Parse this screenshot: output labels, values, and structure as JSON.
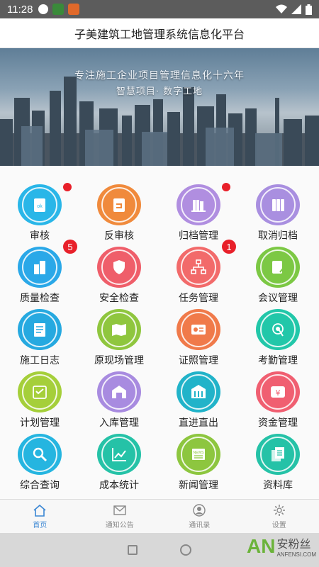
{
  "status": {
    "time": "11:28"
  },
  "title": "子美建筑工地管理系统信息化平台",
  "banner": {
    "line1": "专注施工企业项目管理信息化十六年",
    "line2": "智慧项目· 数字工地"
  },
  "modules": [
    {
      "label": "审核",
      "icon": "clipboard-ok-icon",
      "color": "#29b6e8",
      "badge": "dot"
    },
    {
      "label": "反审核",
      "icon": "clipboard-return-icon",
      "color": "#f08a3c",
      "badge": ""
    },
    {
      "label": "归档管理",
      "icon": "archive-books-icon",
      "color": "#b08ee0",
      "badge": "dot"
    },
    {
      "label": "取消归档",
      "icon": "binders-icon",
      "color": "#a98fe0",
      "badge": ""
    },
    {
      "label": "质量检查",
      "icon": "buildings-icon",
      "color": "#2aa8e8",
      "badge": "5"
    },
    {
      "label": "安全检查",
      "icon": "shield-icon",
      "color": "#ef5e6a",
      "badge": ""
    },
    {
      "label": "任务管理",
      "icon": "org-chart-icon",
      "color": "#f26a6a",
      "badge": "1"
    },
    {
      "label": "会议管理",
      "icon": "document-edit-icon",
      "color": "#7cc844",
      "badge": ""
    },
    {
      "label": "施工日志",
      "icon": "log-icon",
      "color": "#26a9e0",
      "badge": ""
    },
    {
      "label": "原现场管理",
      "icon": "map-icon",
      "color": "#8fc63e",
      "badge": ""
    },
    {
      "label": "证照管理",
      "icon": "id-card-icon",
      "color": "#f07a4a",
      "badge": ""
    },
    {
      "label": "考勤管理",
      "icon": "fingerprint-touch-icon",
      "color": "#22c7a9",
      "badge": ""
    },
    {
      "label": "计划管理",
      "icon": "plan-icon",
      "color": "#a5cf3a",
      "badge": ""
    },
    {
      "label": "入库管理",
      "icon": "warehouse-in-icon",
      "color": "#a88be0",
      "badge": ""
    },
    {
      "label": "直进直出",
      "icon": "gate-icon",
      "color": "#21b3c9",
      "badge": ""
    },
    {
      "label": "资金管理",
      "icon": "yen-icon",
      "color": "#f05f71",
      "badge": ""
    },
    {
      "label": "综合查询",
      "icon": "search-icon",
      "color": "#25b5e0",
      "badge": ""
    },
    {
      "label": "成本统计",
      "icon": "trend-chart-icon",
      "color": "#25c2a7",
      "badge": ""
    },
    {
      "label": "新闻管理",
      "icon": "news-icon",
      "color": "#8dc63f",
      "badge": ""
    },
    {
      "label": "资料库",
      "icon": "documents-icon",
      "color": "#25c2a7",
      "badge": ""
    }
  ],
  "tabs": [
    {
      "label": "首页",
      "icon": "home-icon",
      "active": true
    },
    {
      "label": "通知公告",
      "icon": "envelope-icon",
      "active": false
    },
    {
      "label": "通讯录",
      "icon": "contact-icon",
      "active": false
    },
    {
      "label": "设置",
      "icon": "gear-icon",
      "active": false
    }
  ],
  "watermark": {
    "brand": "AN",
    "cn": "安粉丝",
    "site": "ANFENSI.COM"
  }
}
